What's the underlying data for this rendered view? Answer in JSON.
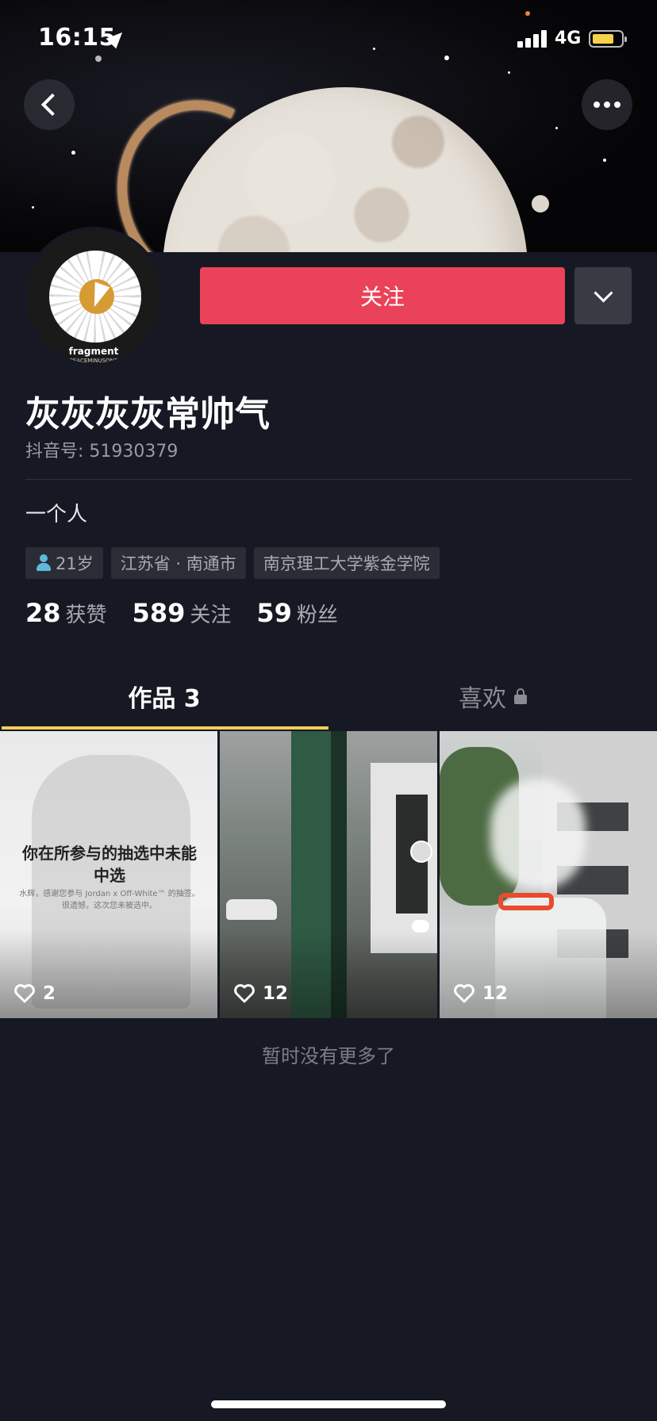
{
  "status_bar": {
    "time": "16:15",
    "network": "4G"
  },
  "profile": {
    "avatar_text_line1": "fragment",
    "avatar_text_line2": "PEACEMINUSONE",
    "follow_label": "关注",
    "name": "灰灰灰灰常帅气",
    "douyin_id": "抖音号: 51930379",
    "bio": "一个人",
    "tags": [
      {
        "icon": "person-icon",
        "label": "21岁"
      },
      {
        "label": "江苏省 · 南通市"
      },
      {
        "label": "南京理工大学紫金学院"
      }
    ],
    "stats": [
      {
        "value": "28",
        "label": "获赞"
      },
      {
        "value": "589",
        "label": "关注"
      },
      {
        "value": "59",
        "label": "粉丝"
      }
    ]
  },
  "tabs": [
    {
      "label": "作品 3",
      "active": true
    },
    {
      "label": "喜欢",
      "locked": true
    }
  ],
  "posts": [
    {
      "title": "你在所参与的抽选中未能中选",
      "subtitle": "水辉，感谢您参与 Jordan x Off-White™ 的抽签。很遗憾，这次您未被选中。",
      "likes": "2"
    },
    {
      "likes": "12"
    },
    {
      "likes": "12"
    }
  ],
  "footer": {
    "no_more": "暂时没有更多了"
  },
  "colors": {
    "background": "#161823",
    "follow_button": "#ea4258",
    "tab_underline": "#f4ce5b"
  }
}
